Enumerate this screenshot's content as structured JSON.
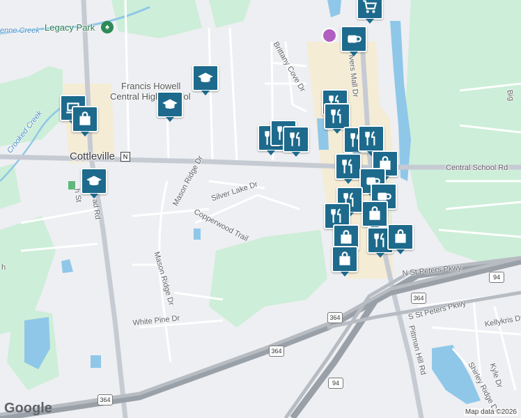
{
  "area": {
    "town": "Cottleville",
    "park": "Legacy Park",
    "school": "Francis Howell Central High School",
    "school_line1": "Francis Howell",
    "school_line2": "Central High School"
  },
  "creeks": {
    "dardenne": "enne Creek",
    "crooked": "Crooked Creek"
  },
  "streets": {
    "central_school": "Central School Rd",
    "silver_lake": "Silver Lake Dr",
    "copperwood": "Copperwood Trail",
    "mason_ridge_top": "Mason Ridge Dr",
    "mason_ridge_bottom": "Mason Ridge Dr",
    "white_pine": "White Pine Dr",
    "brittany_cove": "Brittany Cove Dr",
    "mid_rivers_mall": "ivers Mall Dr",
    "n_st_peters": "N St Peters Pkwy",
    "s_st_peters": "S St Peters Pkwy",
    "pittman_hill": "Pittman Hill Rd",
    "kellykris": "Kellykris Dr",
    "shirley_ridge": "Shirley Ridge Dr",
    "kyle": "Kyle Dr",
    "partial_5th": "h St",
    "partial_rd": "ad Rd",
    "partial_h": "h",
    "big_partial": "Big"
  },
  "route_shields": {
    "r364a": "364",
    "r364b": "364",
    "r364c": "364",
    "r364d": "364",
    "r94a": "94",
    "r94b": "94",
    "n_marker": "N"
  },
  "footer": {
    "logo": "Google",
    "attribution": "Map data ©2026"
  },
  "colors": {
    "road_major": "#c6cbd3",
    "water": "#8fc7e8",
    "park": "#cdeed8",
    "commercial": "#f5ecd6",
    "pin": "#1d6a8c"
  },
  "pins": [
    {
      "icon": "shopping-cart-icon"
    },
    {
      "icon": "coffee-icon"
    },
    {
      "icon": "school-icon"
    },
    {
      "icon": "school-icon"
    },
    {
      "icon": "laptop-icon"
    },
    {
      "icon": "shopping-bag-icon"
    },
    {
      "icon": "school-icon"
    },
    {
      "icon": "restaurant-icon"
    },
    {
      "icon": "restaurant-icon"
    },
    {
      "icon": "restaurant-icon"
    },
    {
      "icon": "restaurant-icon"
    },
    {
      "icon": "restaurant-icon"
    },
    {
      "icon": "restaurant-icon"
    },
    {
      "icon": "restaurant-icon"
    },
    {
      "icon": "shopping-bag-icon"
    },
    {
      "icon": "restaurant-icon"
    },
    {
      "icon": "coffee-icon"
    },
    {
      "icon": "restaurant-icon"
    },
    {
      "icon": "coffee-icon"
    },
    {
      "icon": "shopping-bag-icon"
    },
    {
      "icon": "restaurant-icon"
    },
    {
      "icon": "shopping-bag-icon"
    },
    {
      "icon": "restaurant-icon"
    },
    {
      "icon": "shopping-bag-icon"
    },
    {
      "icon": "shopping-bag-icon"
    }
  ]
}
